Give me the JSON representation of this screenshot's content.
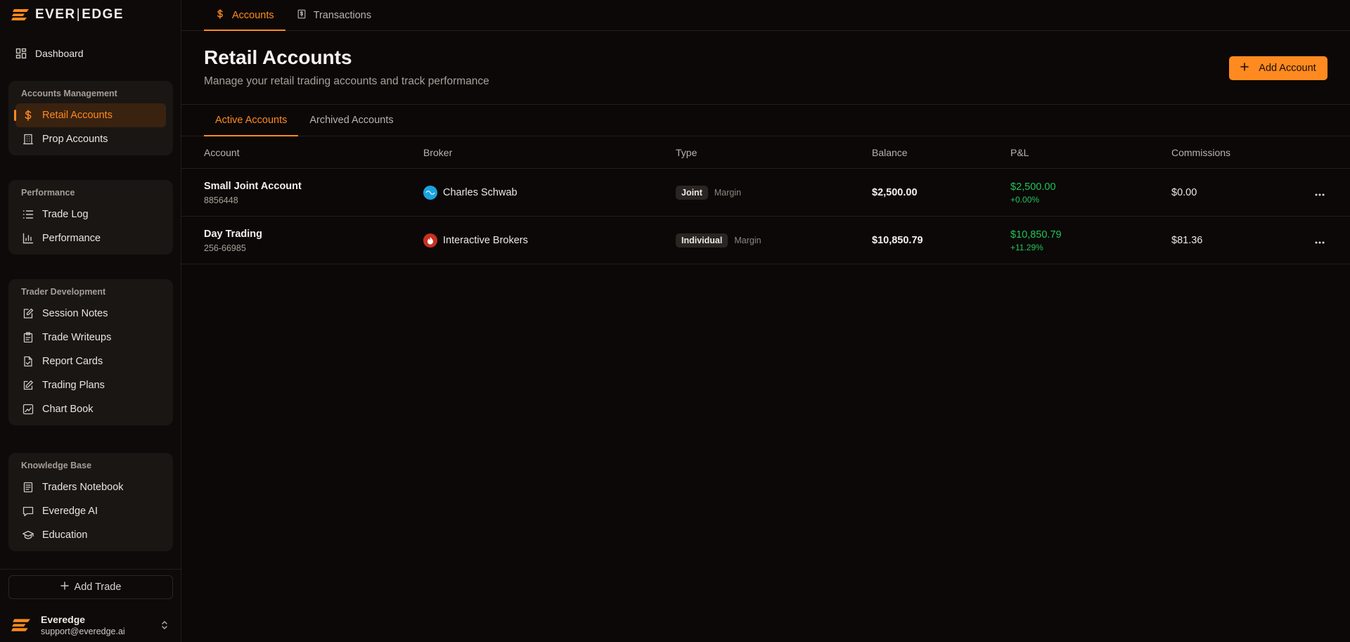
{
  "brand": {
    "left": "EVER",
    "right": "EDGE"
  },
  "sidebar": {
    "dashboard": "Dashboard",
    "groups": [
      {
        "title": "Accounts Management",
        "items": [
          {
            "label": "Retail Accounts",
            "icon": "dollar-icon",
            "active": true
          },
          {
            "label": "Prop Accounts",
            "icon": "bank-icon"
          }
        ]
      },
      {
        "title": "Performance",
        "items": [
          {
            "label": "Trade Log",
            "icon": "list-icon"
          },
          {
            "label": "Performance",
            "icon": "bar-chart-icon"
          }
        ]
      },
      {
        "title": "Trader Development",
        "items": [
          {
            "label": "Session Notes",
            "icon": "note-edit-icon"
          },
          {
            "label": "Trade Writeups",
            "icon": "clipboard-icon"
          },
          {
            "label": "Report Cards",
            "icon": "file-check-icon"
          },
          {
            "label": "Trading Plans",
            "icon": "pencil-square-icon"
          },
          {
            "label": "Chart Book",
            "icon": "chart-image-icon"
          }
        ]
      },
      {
        "title": "Knowledge Base",
        "items": [
          {
            "label": "Traders Notebook",
            "icon": "notebook-icon"
          },
          {
            "label": "Everedge AI",
            "icon": "chat-icon"
          },
          {
            "label": "Education",
            "icon": "graduation-cap-icon"
          }
        ]
      }
    ],
    "add_trade": "Add Trade",
    "user": {
      "name": "Everedge",
      "email": "support@everedge.ai"
    }
  },
  "top_tabs": [
    {
      "label": "Accounts",
      "icon": "dollar-icon",
      "active": true
    },
    {
      "label": "Transactions",
      "icon": "receipt-icon"
    }
  ],
  "header": {
    "title": "Retail Accounts",
    "subtitle": "Manage your retail trading accounts and track performance",
    "add_account": "Add Account"
  },
  "sub_tabs": [
    {
      "label": "Active Accounts",
      "active": true
    },
    {
      "label": "Archived Accounts"
    }
  ],
  "table": {
    "columns": [
      "Account",
      "Broker",
      "Type",
      "Balance",
      "P&L",
      "Commissions"
    ],
    "rows": [
      {
        "name": "Small Joint Account",
        "number": "8856448",
        "broker": "Charles Schwab",
        "broker_color": "#1aa3e0",
        "type": "Joint",
        "type_sub": "Margin",
        "balance": "$2,500.00",
        "pnl": "$2,500.00",
        "pnl_pct": "+0.00%",
        "commissions": "$0.00"
      },
      {
        "name": "Day Trading",
        "number": "256-66985",
        "broker": "Interactive Brokers",
        "broker_color": "#c8311f",
        "type": "Individual",
        "type_sub": "Margin",
        "balance": "$10,850.79",
        "pnl": "$10,850.79",
        "pnl_pct": "+11.29%",
        "commissions": "$81.36"
      }
    ]
  },
  "colors": {
    "accent": "#ff8a1f",
    "positive": "#22c35a",
    "background": "#0b0807"
  }
}
